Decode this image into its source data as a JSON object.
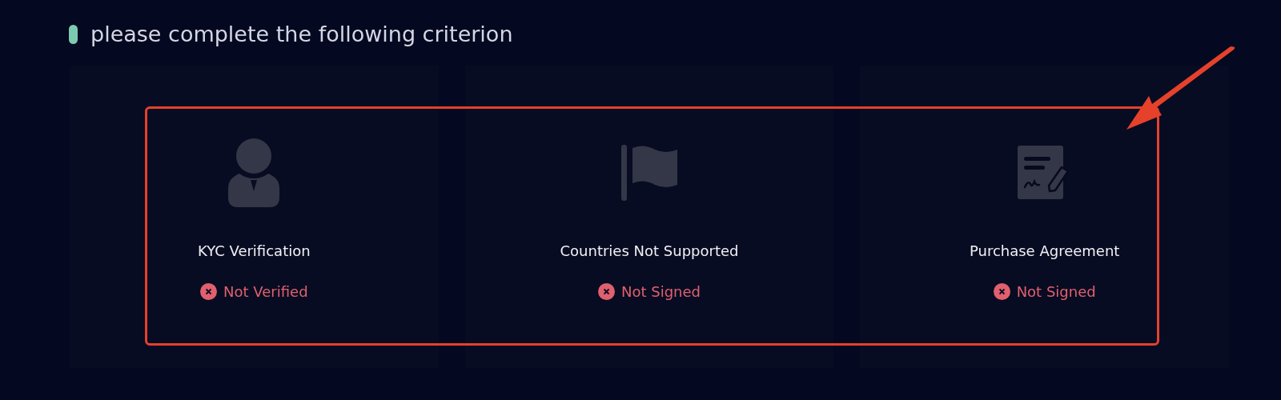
{
  "heading": "please complete the following criterion",
  "criteria": [
    {
      "kind": "person",
      "title": "KYC Verification",
      "done": false,
      "status": "Not Verified"
    },
    {
      "kind": "flag",
      "title": "Countries Not Supported",
      "done": false,
      "status": "Not Signed"
    },
    {
      "kind": "document",
      "title": "Purchase Agreement",
      "done": false,
      "status": "Not Signed"
    }
  ]
}
